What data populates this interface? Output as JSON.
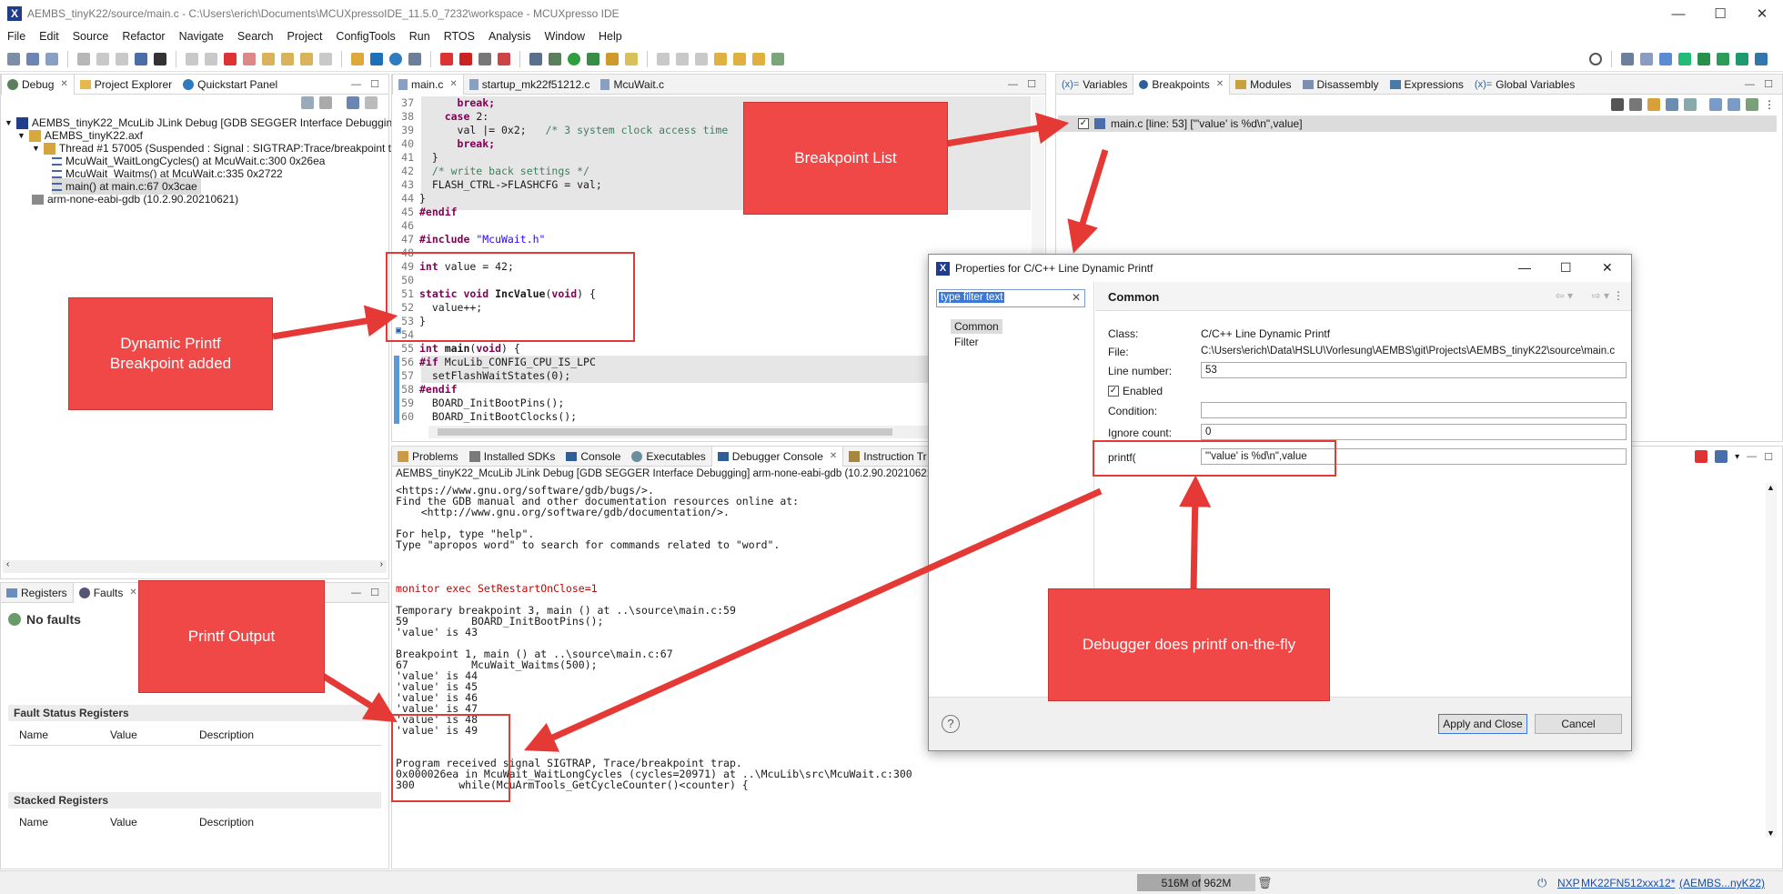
{
  "window": {
    "title": "AEMBS_tinyK22/source/main.c - C:\\Users\\erich\\Documents\\MCUXpressoIDE_11.5.0_7232\\workspace - MCUXpresso IDE",
    "min": "—",
    "max": "☐",
    "close": "✕"
  },
  "menu": [
    "File",
    "Edit",
    "Source",
    "Refactor",
    "Navigate",
    "Search",
    "Project",
    "ConfigTools",
    "Run",
    "RTOS",
    "Analysis",
    "Window",
    "Help"
  ],
  "debug_view": {
    "tabs": [
      "Debug",
      "Project Explorer",
      "Quickstart Panel"
    ],
    "tree": [
      "AEMBS_tinyK22_McuLib JLink Debug [GDB SEGGER Interface Debugging]",
      "AEMBS_tinyK22.axf",
      "Thread #1 57005 (Suspended : Signal : SIGTRAP:Trace/breakpoint tra",
      "McuWait_WaitLongCycles() at McuWait.c:300 0x26ea",
      "McuWait_Waitms() at McuWait.c:335 0x2722",
      "main() at main.c:67 0x3cae",
      "arm-none-eabi-gdb (10.2.90.20210621)"
    ]
  },
  "faults_view": {
    "tabs": [
      "Registers",
      "Faults"
    ],
    "no_faults": "No faults",
    "fault_status_title": "Fault Status Registers",
    "stacked_title": "Stacked Registers",
    "columns": [
      "Name",
      "Value",
      "Description"
    ]
  },
  "editor": {
    "tabs": [
      "main.c",
      "startup_mk22f51212.c",
      "McuWait.c"
    ],
    "lines": [
      {
        "n": "37",
        "t": "      break;"
      },
      {
        "n": "38",
        "t": "    case 2:"
      },
      {
        "n": "39",
        "t": "      val |= 0x2;   /* 3 system clock access time"
      },
      {
        "n": "40",
        "t": "      break;"
      },
      {
        "n": "41",
        "t": "  }"
      },
      {
        "n": "42",
        "t": "  /* write back settings */"
      },
      {
        "n": "43",
        "t": "  FLASH_CTRL->FLASHCFG = val;"
      },
      {
        "n": "44",
        "t": "}"
      },
      {
        "n": "45",
        "t": "#endif"
      },
      {
        "n": "46",
        "t": ""
      },
      {
        "n": "47",
        "t": "#include \"McuWait.h\""
      },
      {
        "n": "48",
        "t": ""
      },
      {
        "n": "49",
        "t": "int value = 42;"
      },
      {
        "n": "50",
        "t": ""
      },
      {
        "n": "51",
        "t": "static void IncValue(void) {"
      },
      {
        "n": "52",
        "t": "  value++;"
      },
      {
        "n": "53",
        "t": "}"
      },
      {
        "n": "54",
        "t": ""
      },
      {
        "n": "55",
        "t": "int main(void) {"
      },
      {
        "n": "56",
        "t": "#if McuLib_CONFIG_CPU_IS_LPC"
      },
      {
        "n": "57",
        "t": "  setFlashWaitStates(0);"
      },
      {
        "n": "58",
        "t": "#endif"
      },
      {
        "n": "59",
        "t": "  BOARD_InitBootPins();"
      },
      {
        "n": "60",
        "t": "  BOARD_InitBootClocks();"
      }
    ]
  },
  "console": {
    "tabs": [
      "Problems",
      "Installed SDKs",
      "Console",
      "Executables",
      "Debugger Console",
      "Instruction Tr"
    ],
    "header": "AEMBS_tinyK22_McuLib JLink Debug [GDB SEGGER Interface Debugging] arm-none-eabi-gdb (10.2.90.20210621)",
    "lines": [
      "<https://www.gnu.org/software/gdb/bugs/>.",
      "Find the GDB manual and other documentation resources online at:",
      "    <http://www.gnu.org/software/gdb/documentation/>.",
      "",
      "For help, type \"help\".",
      "Type \"apropos word\" to search for commands related to \"word\".",
      "",
      "",
      "",
      "monitor exec SetRestartOnClose=1",
      "",
      "Temporary breakpoint 3, main () at ..\\source\\main.c:59",
      "59          BOARD_InitBootPins();",
      "'value' is 43",
      "",
      "Breakpoint 1, main () at ..\\source\\main.c:67",
      "67          McuWait_Waitms(500);",
      "'value' is 44",
      "'value' is 45",
      "'value' is 46",
      "'value' is 47",
      "'value' is 48",
      "'value' is 49",
      "",
      "",
      "Program received signal SIGTRAP, Trace/breakpoint trap.",
      "0x000026ea in McuWait_WaitLongCycles (cycles=20971) at ..\\McuLib\\src\\McuWait.c:300",
      "300       while(McuArmTools_GetCycleCounter()<counter) {"
    ]
  },
  "breakpoints_view": {
    "tabs": [
      "Variables",
      "Breakpoints",
      "Modules",
      "Disassembly",
      "Expressions",
      "Global Variables"
    ],
    "entry": "main.c [line: 53] [\"'value' is %d\\n\",value]"
  },
  "dialog": {
    "title": "Properties for C/C++ Line Dynamic Printf",
    "filter_placeholder": "type filter text",
    "nav": [
      "Common",
      "Filter"
    ],
    "heading": "Common",
    "class_label": "Class:",
    "class_value": "C/C++ Line Dynamic Printf",
    "file_label": "File:",
    "file_value": "C:\\Users\\erich\\Data\\HSLU\\Vorlesung\\AEMBS\\git\\Projects\\AEMBS_tinyK22\\source\\main.c",
    "line_label": "Line number:",
    "line_value": "53",
    "enabled_label": "Enabled",
    "condition_label": "Condition:",
    "condition_value": "",
    "ignore_label": "Ignore count:",
    "ignore_value": "0",
    "printf_label": "printf(",
    "printf_value": "\"'value' is %d\\n\",value",
    "apply_button": "Apply and Close",
    "cancel_button": "Cancel",
    "help": "?"
  },
  "callouts": {
    "breakpoint_list": "Breakpoint List",
    "dynamic_printf": "Dynamic Printf\nBreakpoint added",
    "printf_output": "Printf Output",
    "debugger_printf": "Debugger does printf on-the-fly"
  },
  "status": {
    "heap": "516M of 962M",
    "link_nxp": "NXP",
    "link_device": "MK22FN512xxx12*",
    "link_project": "(AEMBS...nyK22)"
  },
  "colors": {
    "callout_red": "#f04747",
    "box_red": "#e53935",
    "keyword": "#7f0055",
    "comment": "#3f7f5f",
    "string": "#2a00ff",
    "console_blue": "#0000c8",
    "console_red": "#c80000"
  }
}
